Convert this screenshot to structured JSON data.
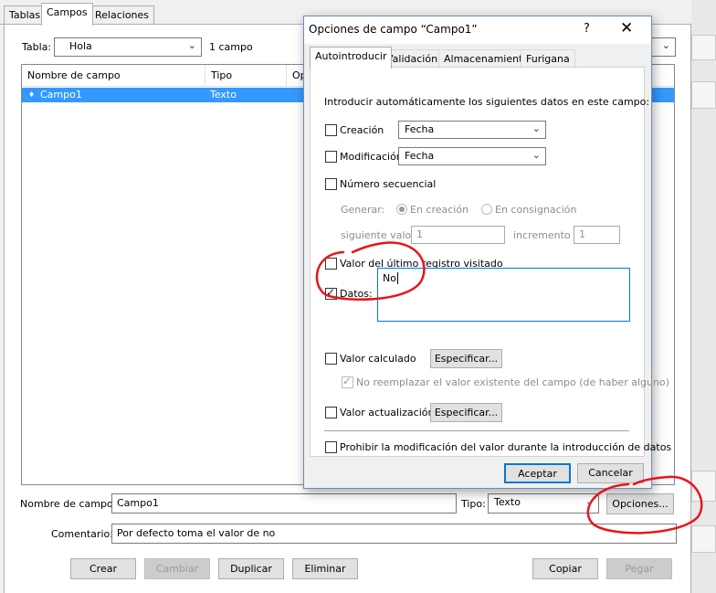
{
  "tabs": [
    {
      "label": "Tablas"
    },
    {
      "label": "Campos"
    },
    {
      "label": "Relaciones"
    }
  ],
  "table_selector": {
    "label": "Tabla:",
    "value": "Hola",
    "count": "1 campo"
  },
  "field_list": {
    "columns": [
      "Nombre de campo",
      "Tipo",
      "Op"
    ],
    "rows": [
      {
        "marker": "♦",
        "name": "Campo1",
        "type": "Texto"
      }
    ]
  },
  "field_form": {
    "name_label": "Nombre de campo:",
    "name_value": "Campo1",
    "type_label": "Tipo:",
    "type_value": "Texto",
    "options_button": "Opciones...",
    "comment_label": "Comentario:",
    "comment_value": "Por defecto toma el valor de no"
  },
  "bottom_buttons": {
    "create": "Crear",
    "change": "Cambiar",
    "duplicate": "Duplicar",
    "delete": "Eliminar",
    "copy": "Copiar",
    "paste": "Pegar"
  },
  "dialog": {
    "title": "Opciones de campo “Campo1”",
    "help": "?",
    "close": "✕",
    "tabs": [
      {
        "label": "Autointroducir"
      },
      {
        "label": "Validación"
      },
      {
        "label": "Almacenamiento"
      },
      {
        "label": "Furigana"
      }
    ],
    "intro": "Introducir automáticamente los siguientes datos en este campo:",
    "creation": {
      "label": "Creación",
      "checked": false,
      "value": "Fecha"
    },
    "modification": {
      "label": "Modificación",
      "checked": false,
      "value": "Fecha"
    },
    "serial": {
      "label": "Número secuencial",
      "checked": false,
      "generate_label": "Generar:",
      "on_creation": "En creación",
      "on_commit": "En consignación",
      "next_value_label": "siguiente valor",
      "next_value": "1",
      "increment_label": "incremento",
      "increment": "1"
    },
    "last_visited": {
      "label": "Valor del último registro visitado",
      "checked": false
    },
    "data": {
      "label": "Datos:",
      "checked": true,
      "value": "No"
    },
    "calculated": {
      "label": "Valor calculado",
      "checked": false,
      "specify": "Especificar...",
      "no_replace": "No reemplazar el valor existente del campo (de haber alguno)",
      "no_replace_checked": true
    },
    "lookup": {
      "label": "Valor actualización",
      "checked": false,
      "specify": "Especificar..."
    },
    "prohibit": {
      "label": "Prohibir la modificación del valor durante la introducción de datos",
      "checked": false
    },
    "ok": "Aceptar",
    "cancel": "Cancelar"
  },
  "colors": {
    "selection": "#3399ff",
    "accent": "#0078d7",
    "annotation": "#e8141c"
  }
}
